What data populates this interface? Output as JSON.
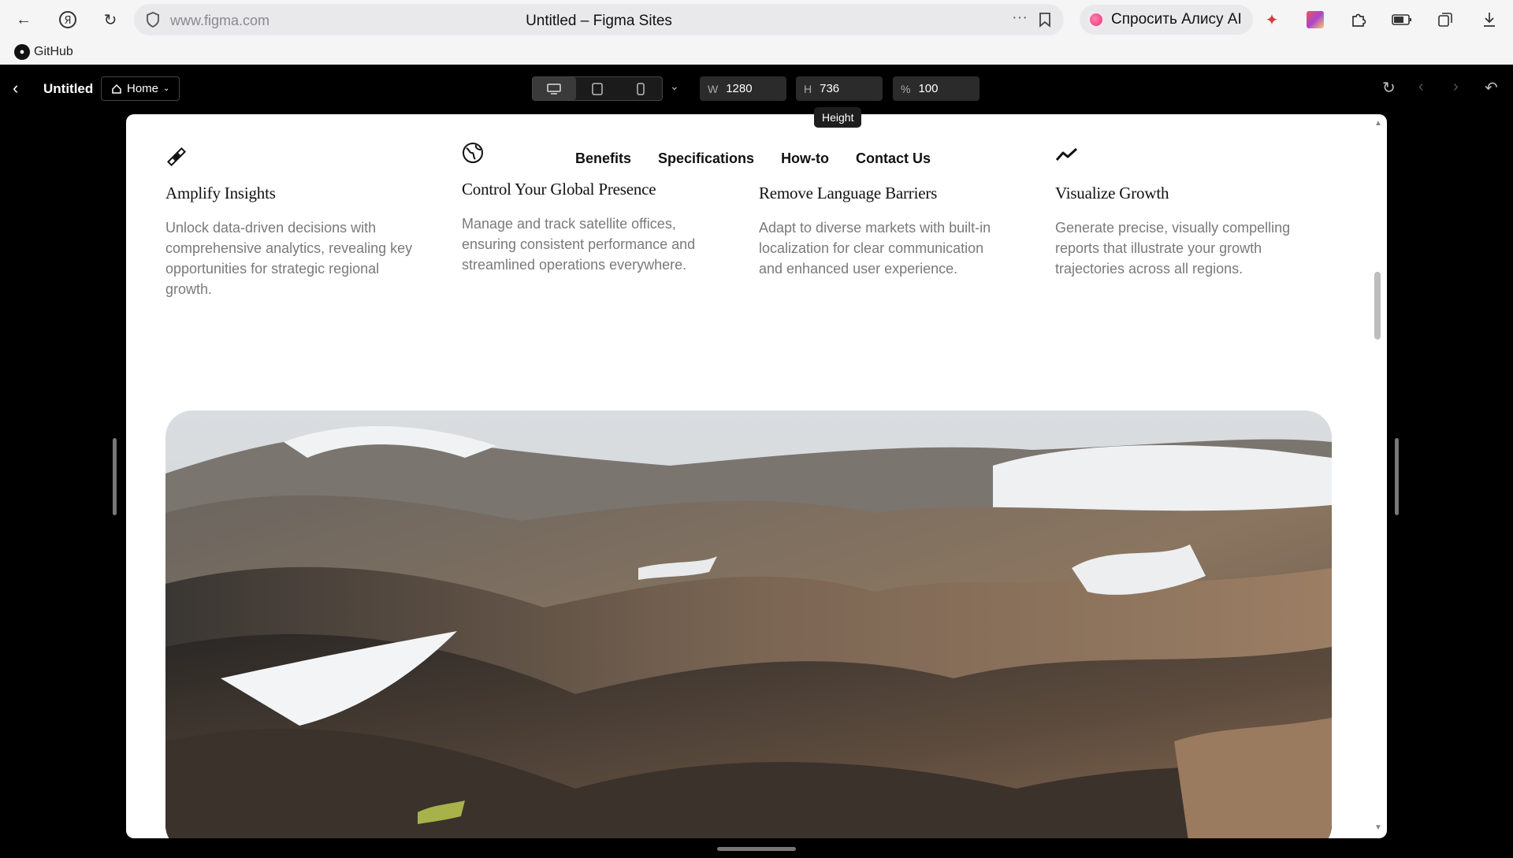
{
  "browser": {
    "url": "www.figma.com",
    "tab_title": "Untitled – Figma Sites",
    "alice_label": "Спросить Алису AI",
    "bookmark": "GitHub"
  },
  "toolbar": {
    "file_name": "Untitled",
    "page_name": "Home",
    "width_label": "W",
    "width_value": "1280",
    "height_label": "H",
    "height_value": "736",
    "zoom_label": "%",
    "zoom_value": "100",
    "tooltip": "Height"
  },
  "site": {
    "nav": [
      "Benefits",
      "Specifications",
      "How-to",
      "Contact Us"
    ],
    "features": [
      {
        "icon": "satellite-icon",
        "title": "Amplify Insights",
        "text": "Unlock data-driven decisions with comprehensive analytics, revealing key opportunities for strategic regional growth."
      },
      {
        "icon": "globe-icon",
        "title": "Control Your Global Presence",
        "text": "Manage and track satellite offices, ensuring consistent performance and streamlined operations everywhere."
      },
      {
        "icon": "translate-icon",
        "title": "Remove Language Barriers",
        "text": "Adapt to diverse markets with built-in localization for clear communication and enhanced user experience."
      },
      {
        "icon": "trend-line-icon",
        "title": "Visualize Growth",
        "text": "Generate precise, visually compelling reports that illustrate your growth trajectories across all regions."
      }
    ],
    "hero_image": "mountain-landscape-photo"
  }
}
